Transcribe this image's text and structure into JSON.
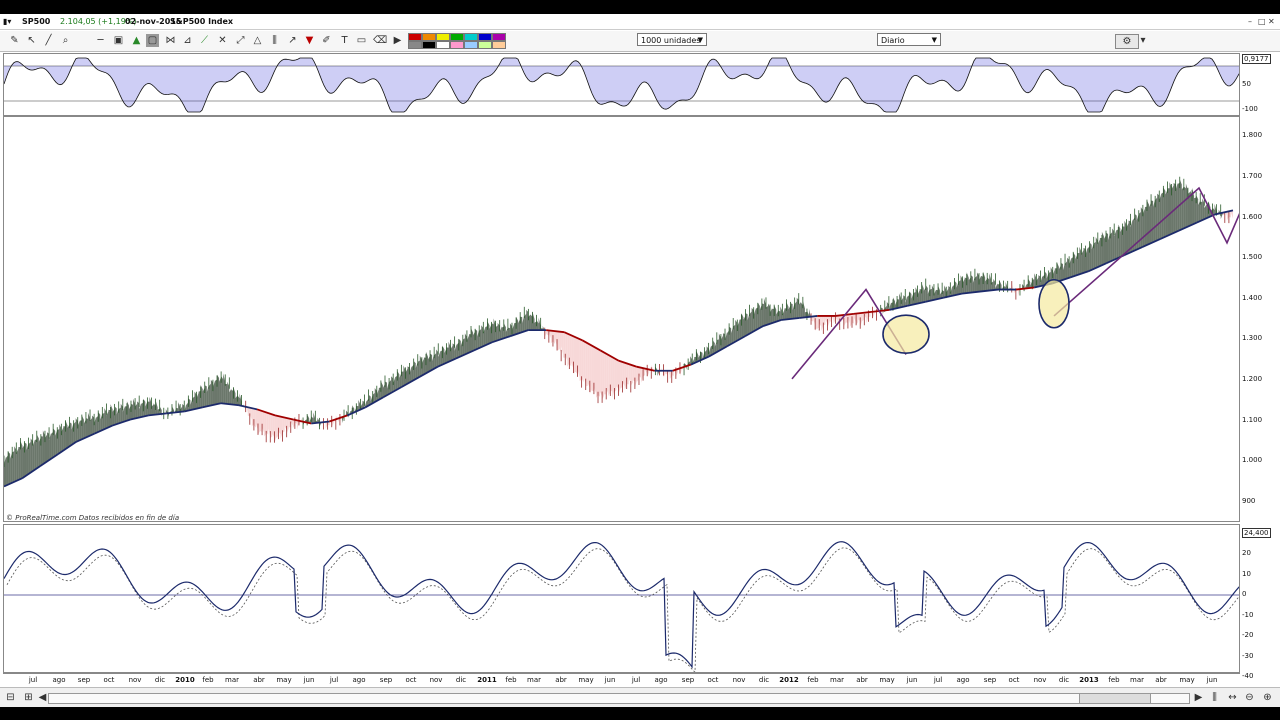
{
  "header": {
    "symbol": "SP500",
    "quote": "2.104,05 (+1,19%)",
    "date": "02-nov-2015",
    "name": "S&P500 Index",
    "window_buttons": [
      "–",
      "□",
      "✕"
    ]
  },
  "toolbar": {
    "units_label": "1000 unidades",
    "period_label": "Diario"
  },
  "watermark": "© ProRealTime.com  Datos recibidos en fin de día",
  "top_indicator": {
    "current_value": "0,9177",
    "ticks": [
      "50",
      "-100"
    ]
  },
  "price_axis": {
    "ticks": [
      "1.800",
      "1.700",
      "1.600",
      "1.500",
      "1.400",
      "1.300",
      "1.200",
      "1.100",
      "1.000",
      "900"
    ]
  },
  "bottom_indicator": {
    "current_value": "24,400",
    "ticks": [
      "20",
      "10",
      "0",
      "-10",
      "-20",
      "-30",
      "-40"
    ]
  },
  "months": [
    {
      "label": "jul",
      "x": 33
    },
    {
      "label": "ago",
      "x": 59
    },
    {
      "label": "sep",
      "x": 84
    },
    {
      "label": "oct",
      "x": 109
    },
    {
      "label": "nov",
      "x": 135
    },
    {
      "label": "dic",
      "x": 160
    },
    {
      "label": "2010",
      "x": 185,
      "year": true
    },
    {
      "label": "feb",
      "x": 208
    },
    {
      "label": "mar",
      "x": 232
    },
    {
      "label": "abr",
      "x": 259
    },
    {
      "label": "may",
      "x": 284
    },
    {
      "label": "jun",
      "x": 309
    },
    {
      "label": "jul",
      "x": 334
    },
    {
      "label": "ago",
      "x": 359
    },
    {
      "label": "sep",
      "x": 386
    },
    {
      "label": "oct",
      "x": 411
    },
    {
      "label": "nov",
      "x": 436
    },
    {
      "label": "dic",
      "x": 461
    },
    {
      "label": "2011",
      "x": 487,
      "year": true
    },
    {
      "label": "feb",
      "x": 511
    },
    {
      "label": "mar",
      "x": 534
    },
    {
      "label": "abr",
      "x": 561
    },
    {
      "label": "may",
      "x": 586
    },
    {
      "label": "jun",
      "x": 610
    },
    {
      "label": "jul",
      "x": 636
    },
    {
      "label": "ago",
      "x": 661
    },
    {
      "label": "sep",
      "x": 688
    },
    {
      "label": "oct",
      "x": 713
    },
    {
      "label": "nov",
      "x": 739
    },
    {
      "label": "dic",
      "x": 764
    },
    {
      "label": "2012",
      "x": 789,
      "year": true
    },
    {
      "label": "feb",
      "x": 813
    },
    {
      "label": "mar",
      "x": 837
    },
    {
      "label": "abr",
      "x": 862
    },
    {
      "label": "may",
      "x": 887
    },
    {
      "label": "jun",
      "x": 912
    },
    {
      "label": "jul",
      "x": 938
    },
    {
      "label": "ago",
      "x": 963
    },
    {
      "label": "sep",
      "x": 990
    },
    {
      "label": "oct",
      "x": 1014
    },
    {
      "label": "nov",
      "x": 1040
    },
    {
      "label": "dic",
      "x": 1064
    },
    {
      "label": "2013",
      "x": 1089,
      "year": true
    },
    {
      "label": "feb",
      "x": 1114
    },
    {
      "label": "mar",
      "x": 1137
    },
    {
      "label": "abr",
      "x": 1161
    },
    {
      "label": "may",
      "x": 1187
    },
    {
      "label": "jun",
      "x": 1212
    }
  ],
  "chart_data": {
    "type": "line",
    "ylim": [
      850,
      1850
    ],
    "series": [
      {
        "values": [
          1010,
          1040,
          1060,
          1080,
          1100,
          1110,
          1130,
          1140,
          1150,
          1120,
          1140,
          1180,
          1210,
          1160,
          1080,
          1060,
          1090,
          1110,
          1090,
          1120,
          1150,
          1190,
          1220,
          1250,
          1270,
          1290,
          1320,
          1340,
          1330,
          1370,
          1320,
          1260,
          1200,
          1160,
          1180,
          1200,
          1230,
          1210,
          1250,
          1280,
          1320,
          1360,
          1390,
          1370,
          1400,
          1330,
          1350,
          1340,
          1360,
          1390,
          1410,
          1430,
          1420,
          1450,
          1460,
          1440,
          1420,
          1450,
          1470,
          1500,
          1530,
          1560,
          1580,
          1620,
          1660,
          1690,
          1650,
          1620,
          1600
        ]
      },
      {
        "values": [
          940,
          960,
          990,
          1020,
          1050,
          1070,
          1090,
          1105,
          1115,
          1120,
          1125,
          1135,
          1145,
          1140,
          1130,
          1115,
          1105,
          1095,
          1100,
          1115,
          1135,
          1160,
          1185,
          1210,
          1235,
          1255,
          1275,
          1295,
          1310,
          1325,
          1325,
          1320,
          1300,
          1275,
          1250,
          1235,
          1225,
          1225,
          1240,
          1260,
          1285,
          1310,
          1335,
          1350,
          1355,
          1360,
          1360,
          1365,
          1370,
          1375,
          1385,
          1395,
          1405,
          1415,
          1420,
          1425,
          1425,
          1430,
          1440,
          1455,
          1470,
          1490,
          1510,
          1530,
          1550,
          1570,
          1590,
          1610,
          1620
        ]
      }
    ]
  },
  "colors": {
    "ma": "#1c2a6b",
    "bear": "#a00000",
    "bull_fill": "#3a4a3a",
    "bear_fill": "#f4c8c8",
    "trend": "#6a2a7a",
    "circle": "#f5e9a0"
  }
}
